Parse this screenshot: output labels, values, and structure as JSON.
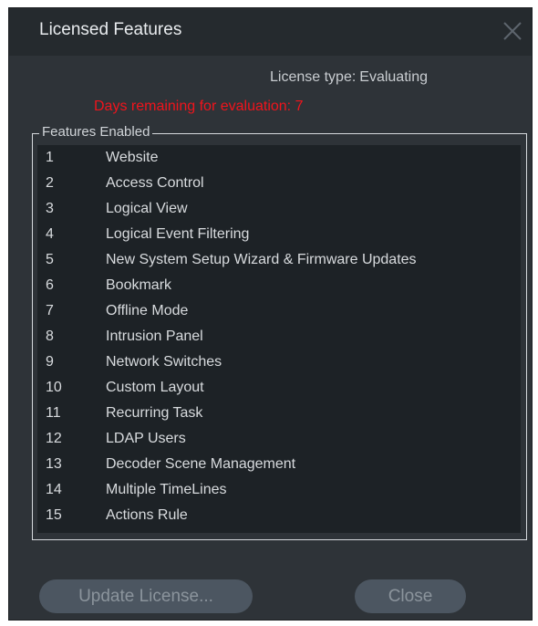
{
  "dialog": {
    "title": "Licensed Features",
    "license_type_label": "License type:",
    "license_type_value": "Evaluating",
    "days_remaining_label": "Days remaining for evaluation:",
    "days_remaining_value": "7",
    "features_legend": "Features Enabled",
    "features": [
      {
        "num": "1",
        "name": "Website"
      },
      {
        "num": "2",
        "name": "Access Control"
      },
      {
        "num": "3",
        "name": "Logical View"
      },
      {
        "num": "4",
        "name": "Logical Event Filtering"
      },
      {
        "num": "5",
        "name": "New System Setup Wizard & Firmware Updates"
      },
      {
        "num": "6",
        "name": "Bookmark"
      },
      {
        "num": "7",
        "name": "Offline Mode"
      },
      {
        "num": "8",
        "name": "Intrusion Panel"
      },
      {
        "num": "9",
        "name": "Network Switches"
      },
      {
        "num": "10",
        "name": "Custom Layout"
      },
      {
        "num": "11",
        "name": "Recurring Task"
      },
      {
        "num": "12",
        "name": "LDAP Users"
      },
      {
        "num": "13",
        "name": "Decoder Scene Management"
      },
      {
        "num": "14",
        "name": "Multiple TimeLines"
      },
      {
        "num": "15",
        "name": "Actions Rule"
      }
    ],
    "update_license_label": "Update License...",
    "close_label": "Close"
  },
  "icons": {
    "close": "close-icon"
  },
  "colors": {
    "background": "#2e3338",
    "list_background": "#1d2226",
    "warning_text": "#f0141c",
    "button_background": "#4c5661"
  }
}
